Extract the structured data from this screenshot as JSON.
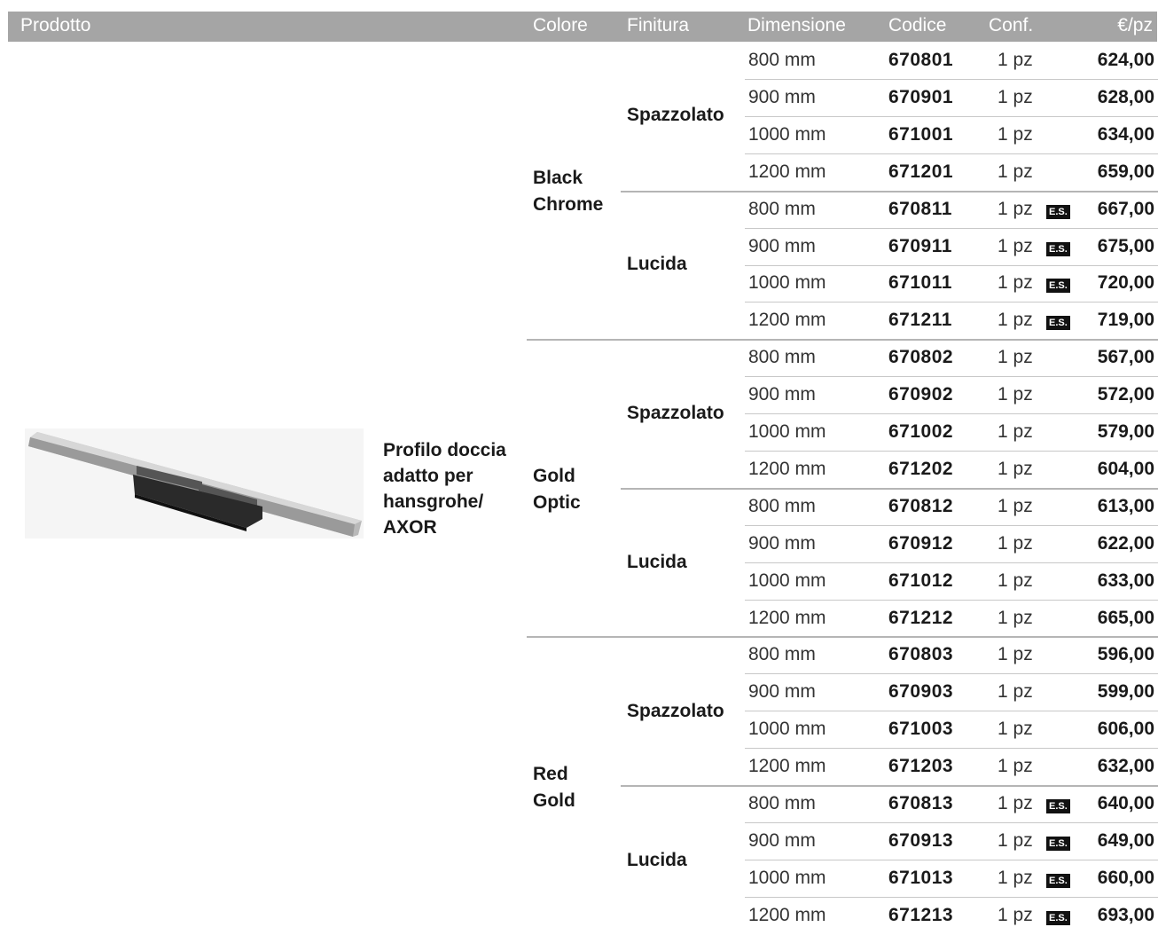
{
  "header": {
    "prodotto": "Prodotto",
    "colore": "Colore",
    "finitura": "Finitura",
    "dimensione": "Dimensione",
    "codice": "Codice",
    "conf": "Conf.",
    "prezzo": "€/pz"
  },
  "product": {
    "name_lines": [
      "Profilo doccia",
      "adatto per",
      "hansgrohe/",
      "AXOR"
    ],
    "image": "shower-drain-profile"
  },
  "colors": [
    {
      "label_lines": [
        "Black",
        "Chrome"
      ],
      "finishes": [
        {
          "label": "Spazzolato",
          "rows": [
            {
              "dim": "800 mm",
              "code": "670801",
              "conf": "1 pz",
              "es": "",
              "price": "624,00"
            },
            {
              "dim": "900 mm",
              "code": "670901",
              "conf": "1 pz",
              "es": "",
              "price": "628,00"
            },
            {
              "dim": "1000 mm",
              "code": "671001",
              "conf": "1 pz",
              "es": "",
              "price": "634,00"
            },
            {
              "dim": "1200 mm",
              "code": "671201",
              "conf": "1 pz",
              "es": "",
              "price": "659,00"
            }
          ]
        },
        {
          "label": "Lucida",
          "rows": [
            {
              "dim": "800 mm",
              "code": "670811",
              "conf": "1 pz",
              "es": "E.S.",
              "price": "667,00"
            },
            {
              "dim": "900 mm",
              "code": "670911",
              "conf": "1 pz",
              "es": "E.S.",
              "price": "675,00"
            },
            {
              "dim": "1000 mm",
              "code": "671011",
              "conf": "1 pz",
              "es": "E.S.",
              "price": "720,00"
            },
            {
              "dim": "1200 mm",
              "code": "671211",
              "conf": "1 pz",
              "es": "E.S.",
              "price": "719,00"
            }
          ]
        }
      ]
    },
    {
      "label_lines": [
        "Gold",
        "Optic"
      ],
      "finishes": [
        {
          "label": "Spazzolato",
          "rows": [
            {
              "dim": "800 mm",
              "code": "670802",
              "conf": "1 pz",
              "es": "",
              "price": "567,00"
            },
            {
              "dim": "900 mm",
              "code": "670902",
              "conf": "1 pz",
              "es": "",
              "price": "572,00"
            },
            {
              "dim": "1000 mm",
              "code": "671002",
              "conf": "1 pz",
              "es": "",
              "price": "579,00"
            },
            {
              "dim": "1200 mm",
              "code": "671202",
              "conf": "1 pz",
              "es": "",
              "price": "604,00"
            }
          ]
        },
        {
          "label": "Lucida",
          "rows": [
            {
              "dim": "800 mm",
              "code": "670812",
              "conf": "1 pz",
              "es": "",
              "price": "613,00"
            },
            {
              "dim": "900 mm",
              "code": "670912",
              "conf": "1 pz",
              "es": "",
              "price": "622,00"
            },
            {
              "dim": "1000 mm",
              "code": "671012",
              "conf": "1 pz",
              "es": "",
              "price": "633,00"
            },
            {
              "dim": "1200 mm",
              "code": "671212",
              "conf": "1 pz",
              "es": "",
              "price": "665,00"
            }
          ]
        }
      ]
    },
    {
      "label_lines": [
        "Red",
        "Gold"
      ],
      "finishes": [
        {
          "label": "Spazzolato",
          "rows": [
            {
              "dim": "800 mm",
              "code": "670803",
              "conf": "1 pz",
              "es": "",
              "price": "596,00"
            },
            {
              "dim": "900 mm",
              "code": "670903",
              "conf": "1 pz",
              "es": "",
              "price": "599,00"
            },
            {
              "dim": "1000 mm",
              "code": "671003",
              "conf": "1 pz",
              "es": "",
              "price": "606,00"
            },
            {
              "dim": "1200 mm",
              "code": "671203",
              "conf": "1 pz",
              "es": "",
              "price": "632,00"
            }
          ]
        },
        {
          "label": "Lucida",
          "rows": [
            {
              "dim": "800 mm",
              "code": "670813",
              "conf": "1 pz",
              "es": "E.S.",
              "price": "640,00"
            },
            {
              "dim": "900 mm",
              "code": "670913",
              "conf": "1 pz",
              "es": "E.S.",
              "price": "649,00"
            },
            {
              "dim": "1000 mm",
              "code": "671013",
              "conf": "1 pz",
              "es": "E.S.",
              "price": "660,00"
            },
            {
              "dim": "1200 mm",
              "code": "671213",
              "conf": "1 pz",
              "es": "E.S.",
              "price": "693,00"
            }
          ]
        }
      ]
    }
  ]
}
